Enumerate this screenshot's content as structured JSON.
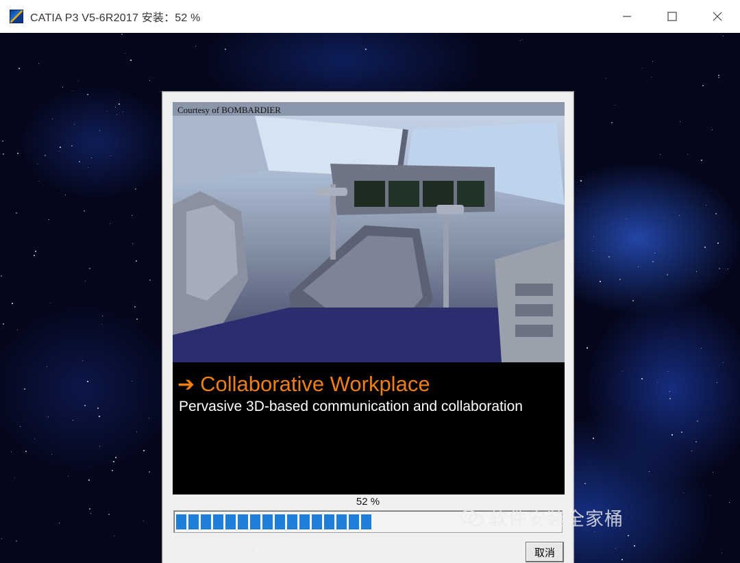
{
  "window": {
    "title": "CATIA P3 V5-6R2017 安装：52 %",
    "icon": "catia-app-icon",
    "controls": [
      "minimize-icon",
      "maximize-icon",
      "close-icon"
    ]
  },
  "splash": {
    "courtesy": "Courtesy of BOMBARDIER",
    "headline_arrow": "➔",
    "headline": "Collaborative Workplace",
    "subline": "Pervasive 3D-based communication and collaboration"
  },
  "progress": {
    "label": "52 %",
    "value": 0.52,
    "color": "#1f7ed8"
  },
  "buttons": {
    "cancel": "取消"
  },
  "watermark": {
    "text": "软件安装全家桶",
    "icon": "wechat-icon"
  },
  "colors": {
    "headline": "#f07f12",
    "splash_bg": "#000000",
    "dialog_bg": "#f0f0f0"
  }
}
